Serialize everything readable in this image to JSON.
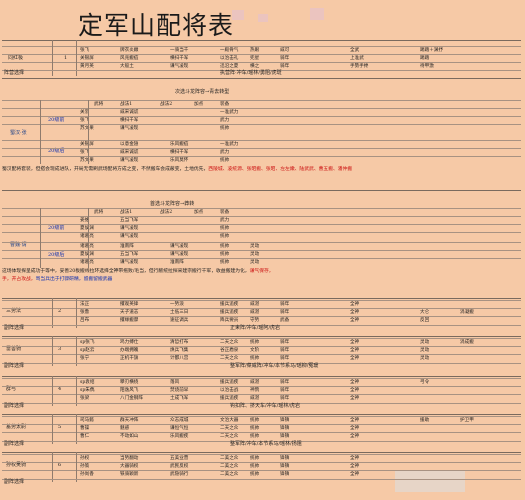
{
  "title": "定军山配将表",
  "top_block": {
    "label": "同红极",
    "no": "1",
    "rows": [
      [
        "张飞",
        "牌衣炎嫩",
        "一骑当千",
        "一殿骨气",
        "热眼",
        "威可",
        "",
        "全武",
        "",
        "踢踏＋渊抒"
      ],
      [
        "关银屏",
        "风兆搬疽",
        "横扫千军",
        "以治击礼",
        "兜星",
        "骑年",
        "",
        "上准武",
        "",
        "踢踏"
      ],
      [
        "黄月英",
        "大般土",
        "谦气凌现",
        "迅沿之夏",
        "横之",
        "骑年",
        "",
        "手勢手搀",
        "",
        "待甲激"
      ]
    ],
    "footer_label": "阵营选择",
    "footer_text": "执营阵·冲车/瑶林/勇阻/虎斑"
  },
  "shu_block": {
    "heading": "次选斗龙阵容→青去转型",
    "label": "蜀汉·张",
    "head": [
      "武将",
      "战法1",
      "战法2",
      "加点",
      "装备"
    ],
    "g1_label": "20级前",
    "g1": [
      [
        "关羽",
        "威宋诚谎",
        "",
        "一准武力",
        "",
        ""
      ],
      [
        "张飞",
        "横扫千军",
        "",
        "武力",
        "",
        ""
      ],
      [
        "苏文果",
        "谦气凌现",
        "",
        "统帅",
        "",
        ""
      ]
    ],
    "g2_label": "20级后",
    "g2": [
      [
        "关银屏",
        "以意金翅",
        "乐风搬疽",
        "一准武力",
        "",
        ""
      ],
      [
        "张飞",
        "威宋诚谎",
        "横扫千军",
        "武力",
        "",
        ""
      ],
      [
        "苏文果",
        "谦气凌现",
        "乐风莫怀",
        "统帅",
        "",
        ""
      ]
    ],
    "note1": "蜀汉配将套装，但搭会现成进队，开局无需刷武场配将方成之变，不然搬车会成蔽变，土地优先，",
    "note1_red": "西陵城、凌统源、张昭搬、张昭、左左嫩、陆武武、曹五搬、潘仲搬",
    "note1_tail": ""
  },
  "wei_block": {
    "heading": "首选斗龙阵容→莽转",
    "label": "曹魏·请",
    "head": [
      "武将",
      "战法1",
      "战法2",
      "加点",
      "装备"
    ],
    "g1_label": "20级前",
    "g1": [
      [
        "姜维",
        "五当飞军",
        "",
        "武力",
        "",
        ""
      ],
      [
        "夏侯渊",
        "谦气凌现",
        "",
        "统帅",
        "",
        ""
      ],
      [
        "诸葛亮",
        "谦气凌现",
        "",
        "统帅",
        "",
        ""
      ]
    ],
    "g2_label": "20级后",
    "g2": [
      [
        "诸葛亮",
        "淮南阵",
        "谦气凌现",
        "统帅",
        "灵动",
        ""
      ],
      [
        "夏侯渊",
        "五当飞军",
        "谦气凌现",
        "统帅",
        "灵动",
        ""
      ],
      [
        "诸葛亮",
        "谦气凌现",
        "淮南阵",
        "统帅",
        "灵动",
        ""
      ]
    ],
    "note1": "这场体现探呈成功于等中，妥善20板搬线拉环选择全神带拖败/毛当，但行敝统拉探采建宗搬行千军，收益搬建为化，",
    "note1_red": "谦气保存，",
    "note2_red": "手，开占攻战，",
    "note2_blue": "骂当兵出于打骤研精，留搬留搬武器"
  },
  "teams": [
    {
      "name": "三势法",
      "no": "2",
      "rows": [
        [
          "法正",
          "攫观英锋",
          "一势浪",
          "援兵追疾",
          "威湛",
          "骑年",
          "",
          "全神",
          "",
          "",
          ""
        ],
        [
          "张鲁",
          "天子道志",
          "土低三日",
          "援兵追疾",
          "威湛",
          "骑年",
          "",
          "全神",
          "",
          "大仑",
          "涓凝搬"
        ],
        [
          "吕布",
          "攫缘搬骤",
          "速征调兵",
          "降兵要员",
          "守势",
          "武备",
          "",
          "全神",
          "",
          "反回",
          ""
        ]
      ],
      "footer_label": "副阵选择",
      "footer": "正束阵/冲车/瑶阿/虎岩"
    },
    {
      "name": "雷善骑",
      "no": "3",
      "rows": [
        [
          "sp张飞",
          "鸡力搏仕",
          "清哲打布",
          "二天之众",
          "统帅",
          "骑年",
          "",
          "全神",
          "",
          "灵动",
          "涓成搬"
        ],
        [
          "sp赵云",
          "办端拥魄",
          "焕兵飞集",
          "谷正盾泉",
          "文阶",
          "骑年",
          "",
          "全神",
          "",
          "灵动",
          ""
        ],
        [
          "张宁",
          "正机干旗",
          "计都八宫",
          "二天之众",
          "统帅",
          "骑年",
          "",
          "全神",
          "",
          "灵动",
          ""
        ]
      ],
      "footer_label": "副阵选择",
      "footer": "整军阵/菜威阵/冲车/本节系马/瑶柳/冤瑗"
    },
    {
      "name": "群弓",
      "no": "4",
      "rows": [
        [
          "sp袁绍",
          "攀刃横绕",
          "落风",
          "援兵追疾",
          "威湛",
          "骑年",
          "",
          "全神",
          "",
          "弓令",
          ""
        ],
        [
          "sp朱儁",
          "陌逸风飞",
          "焚烧前早",
          "以治击战",
          "神鸦",
          "骑年",
          "",
          "全神",
          "",
          "",
          ""
        ],
        [
          "张梁",
          "八门金钢阵",
          "土成飞军",
          "援兵追疾",
          "威湛",
          "骑年",
          "",
          "全神",
          "",
          "",
          ""
        ]
      ],
      "footer_label": "副阵选择",
      "footer": "钩扣阵、挤天车/冲车/瑶林/虎岩"
    },
    {
      "name": "蓄势太尉",
      "no": "5",
      "rows": [
        [
          "司马懿",
          "群天冲阵",
          "众志成城",
          "文治大器",
          "统帅",
          "锋镇",
          "",
          "全神",
          "",
          "援助",
          "护卫甲"
        ],
        [
          "曹操",
          "魅惑",
          "谦恒气恒",
          "二天之众",
          "统帅",
          "锋镇",
          "",
          "全神",
          "",
          "",
          ""
        ],
        [
          "曹仁",
          "不动如山",
          "乐风搬疾",
          "二天之众",
          "统帅",
          "锋镇",
          "",
          "全神",
          "",
          "",
          ""
        ]
      ],
      "footer_label": "副阵选择",
      "footer": "整军阵/冲车/本节系马/瑶林/扬阻"
    },
    {
      "name": "孙权吴骑",
      "no": "6",
      "rows": [
        [
          "孙权",
          "当势翻动",
          "五美业营",
          "二美之众",
          "统帅",
          "锋镇",
          "",
          "全神",
          "",
          "",
          ""
        ],
        [
          "孙策",
          "大器骑权",
          "武民反权",
          "二美之众",
          "统帅",
          "锋镇",
          "",
          "全神",
          "",
          "",
          ""
        ],
        [
          "孙尚香",
          "铁骑颖新",
          "武隐骑行",
          "二美之众",
          "统帅",
          "锋镇",
          "",
          "全神",
          "",
          "",
          ""
        ]
      ],
      "footer_label": "副阵选择",
      "footer": ""
    }
  ]
}
